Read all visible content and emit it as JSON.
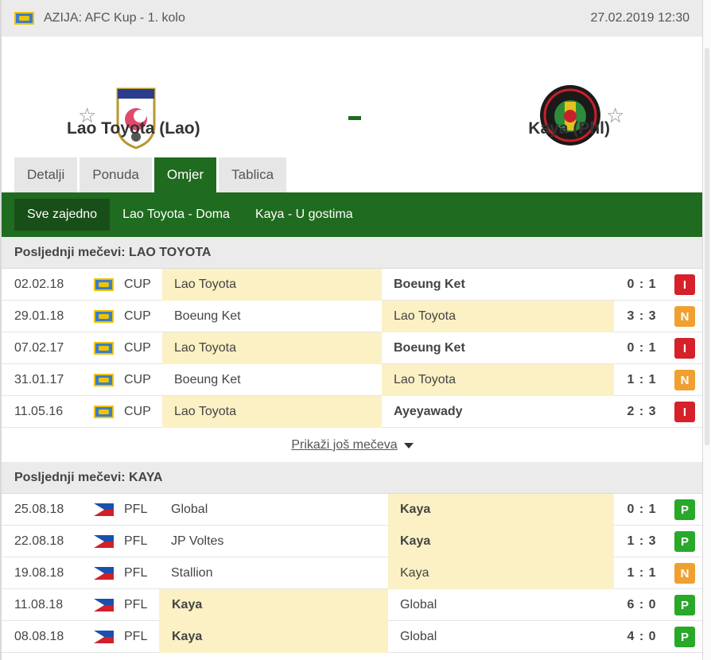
{
  "header": {
    "league": "AZIJA: AFC Kup - 1. kolo",
    "datetime": "27.02.2019 12:30"
  },
  "match": {
    "home_team": "Lao Toyota (Lao)",
    "away_team": "Kaya (Phl)",
    "score": "-"
  },
  "tabs": [
    {
      "label": "Detalji"
    },
    {
      "label": "Ponuda"
    },
    {
      "label": "Omjer"
    },
    {
      "label": "Tablica"
    }
  ],
  "subtabs": [
    {
      "label": "Sve zajedno"
    },
    {
      "label": "Lao Toyota - Doma"
    },
    {
      "label": "Kaya - U gostima"
    }
  ],
  "section_lao": {
    "title": "Posljednji mečevi: LAO TOYOTA",
    "rows": [
      {
        "date": "02.02.18",
        "comp": "CUP",
        "home": "Lao Toyota",
        "away": "Boeung Ket",
        "score": "0 : 1",
        "result": "I"
      },
      {
        "date": "29.01.18",
        "comp": "CUP",
        "home": "Boeung Ket",
        "away": "Lao Toyota",
        "score": "3 : 3",
        "result": "N"
      },
      {
        "date": "07.02.17",
        "comp": "CUP",
        "home": "Lao Toyota",
        "away": "Boeung Ket",
        "score": "0 : 1",
        "result": "I"
      },
      {
        "date": "31.01.17",
        "comp": "CUP",
        "home": "Boeung Ket",
        "away": "Lao Toyota",
        "score": "1 : 1",
        "result": "N"
      },
      {
        "date": "11.05.16",
        "comp": "CUP",
        "home": "Lao Toyota",
        "away": "Ayeyawady",
        "score": "2 : 3",
        "result": "I"
      }
    ]
  },
  "show_more": "Prikaži još mečeva",
  "section_kaya": {
    "title": "Posljednji mečevi: KAYA",
    "rows": [
      {
        "date": "25.08.18",
        "comp": "PFL",
        "home": "Global",
        "away": "Kaya",
        "score": "0 : 1",
        "result": "P"
      },
      {
        "date": "22.08.18",
        "comp": "PFL",
        "home": "JP Voltes",
        "away": "Kaya",
        "score": "1 : 3",
        "result": "P"
      },
      {
        "date": "19.08.18",
        "comp": "PFL",
        "home": "Stallion",
        "away": "Kaya",
        "score": "1 : 1",
        "result": "N"
      },
      {
        "date": "11.08.18",
        "comp": "PFL",
        "home": "Kaya",
        "away": "Global",
        "score": "6 : 0",
        "result": "P"
      },
      {
        "date": "08.08.18",
        "comp": "PFL",
        "home": "Kaya",
        "away": "Global",
        "score": "4 : 0",
        "result": "P"
      }
    ]
  },
  "colors": {
    "brand_green": "#1f6b1f",
    "highlight": "#fbf1c4",
    "loss": "#d6202a",
    "draw": "#f0a030",
    "win": "#2aa82a"
  }
}
